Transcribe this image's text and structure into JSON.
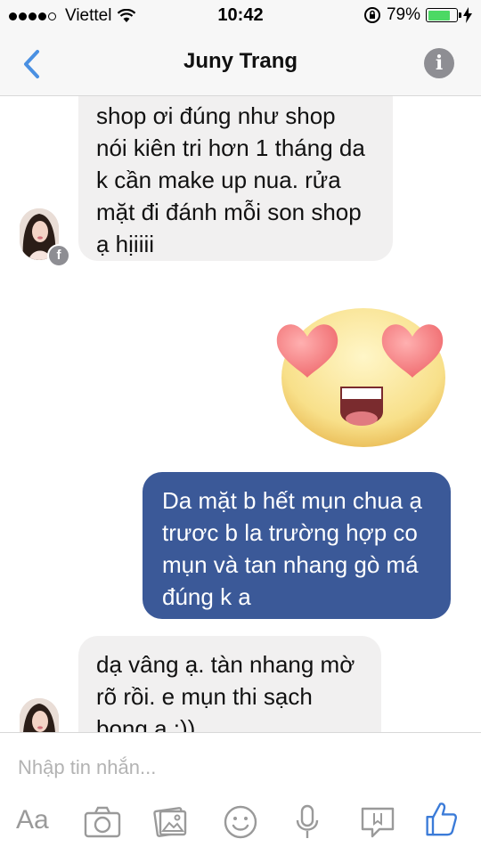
{
  "status_bar": {
    "carrier": "Viettel",
    "time": "10:42",
    "battery_percent": "79%",
    "battery_level": 0.79,
    "signal_bars": 4
  },
  "nav": {
    "title": "Juny Trang",
    "back_icon": "chevron-left-icon",
    "info_icon": "info-icon"
  },
  "messages": [
    {
      "direction": "incoming",
      "text": "shop ơi đúng như shop\nnói kiên tri hơn 1 tháng da\nk cần make up nua. rửa\nmặt đi đánh mỗi son shop\nạ hịiiii"
    },
    {
      "direction": "outgoing",
      "type": "sticker",
      "sticker": "heart-eyes-emoji"
    },
    {
      "direction": "outgoing",
      "text": "Da mặt b hết mụn chua ạ\ntrươc b la trường hợp co\nmụn và tan nhang gò má\nđúng k a"
    },
    {
      "direction": "incoming",
      "text": "dạ vâng ạ. tàn nhang mờ\nrõ rồi. e mụn thi sạch\nbong a :))"
    }
  ],
  "composer": {
    "placeholder": "Nhập tin nhắn...",
    "aa_label": "Aa",
    "tools": [
      "camera-icon",
      "gallery-icon",
      "emoji-icon",
      "microphone-icon",
      "sticker-icon",
      "like-icon"
    ]
  },
  "colors": {
    "accent": "#4a90e2",
    "outgoing_bubble": "#3b5998",
    "incoming_bubble": "#f1f0f0",
    "battery": "#4cd964",
    "like": "#3b7bd8"
  }
}
